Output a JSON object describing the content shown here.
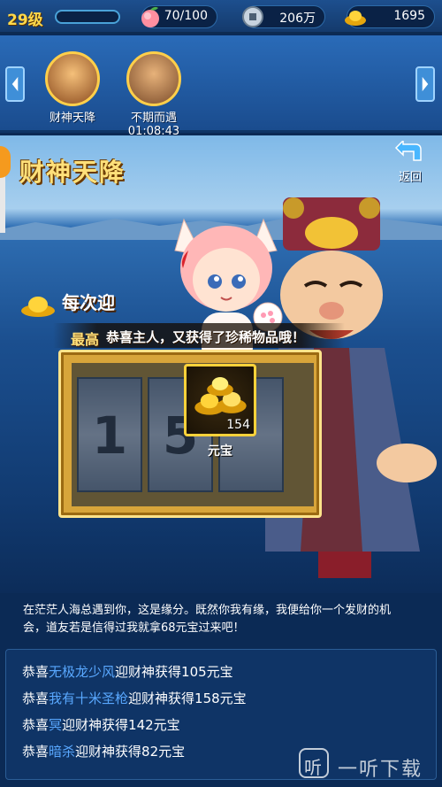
{
  "player": {
    "level": "29级"
  },
  "resources": {
    "stamina": "70/100",
    "coins": "206万",
    "gold": "1695"
  },
  "events": [
    {
      "name": "财神天降",
      "timer": ""
    },
    {
      "name": "不期而遇",
      "timer": "01:08:43"
    }
  ],
  "page": {
    "title": "财神天降",
    "back_label": "返回"
  },
  "promo": {
    "headline": "每次迎",
    "subhead": "最高",
    "congrats": "恭喜主人，又获得了珍稀物品哦！"
  },
  "slot": {
    "reels": [
      "1",
      "5",
      ""
    ]
  },
  "reward": {
    "count": "154",
    "name": "元宝"
  },
  "description": "在茫茫人海总遇到你，这是缘分。既然你我有缘，我便给你一个发财的机会，道友若是信得过我就拿68元宝过来吧！",
  "feed": [
    {
      "prefix": "恭喜",
      "player": "无极龙少风",
      "suffix": "迎财神获得105元宝"
    },
    {
      "prefix": "恭喜",
      "player": "我有十米圣枪",
      "suffix": "迎财神获得158元宝"
    },
    {
      "prefix": "恭喜",
      "player": "冥",
      "suffix": "迎财神获得142元宝"
    },
    {
      "prefix": "恭喜",
      "player": "暗杀",
      "suffix": "迎财神获得82元宝"
    }
  ],
  "watermark": {
    "icon": "听",
    "text": "一听下载"
  },
  "colors": {
    "accent_gold": "#ffd94a",
    "player_name": "#59a8ff",
    "panel": "#0f3466"
  }
}
